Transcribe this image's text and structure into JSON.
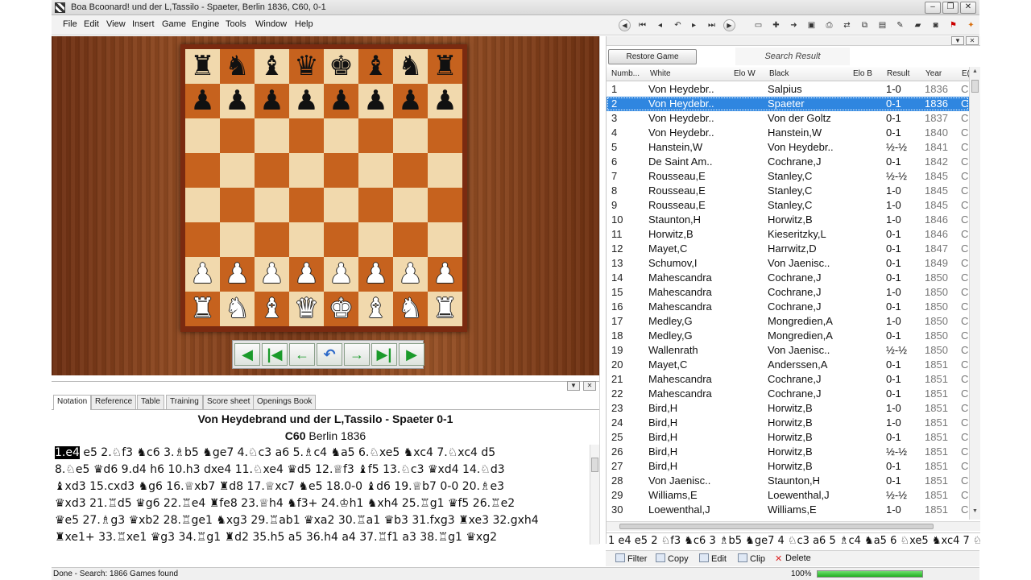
{
  "window": {
    "title": "Boa Bcoonard! und der L,Tassilo - Spaeter, Berlin 1836, C60, 0-1",
    "controls": [
      "–",
      "❐",
      "✕"
    ]
  },
  "menu": [
    "File",
    "Edit",
    "View",
    "Insert",
    "Game",
    "Engine",
    "Tools",
    "Window",
    "Help"
  ],
  "toolbar_icons": [
    "nav-back-icon",
    "nav-first-icon",
    "nav-prev-icon",
    "nav-undo-icon",
    "nav-next-icon",
    "nav-last-icon",
    "nav-forward-icon",
    "new-doc-icon",
    "insert-icon",
    "export-icon",
    "save-icon",
    "print-icon",
    "import-icon",
    "copy-icon",
    "clipboard-icon",
    "edit-icon",
    "eraser-icon",
    "camera-icon",
    "pdf-icon",
    "plugin-icon"
  ],
  "board": {
    "ranks": [
      [
        "r",
        "n",
        "b",
        "q",
        "k",
        "b",
        "n",
        "r"
      ],
      [
        "p",
        "p",
        "p",
        "p",
        "p",
        "p",
        "p",
        "p"
      ],
      [
        "",
        "",
        "",
        "",
        "",
        "",
        "",
        ""
      ],
      [
        "",
        "",
        "",
        "",
        "",
        "",
        "",
        ""
      ],
      [
        "",
        "",
        "",
        "",
        "",
        "",
        "",
        ""
      ],
      [
        "",
        "",
        "",
        "",
        "",
        "",
        "",
        ""
      ],
      [
        "P",
        "P",
        "P",
        "P",
        "P",
        "P",
        "P",
        "P"
      ],
      [
        "R",
        "N",
        "B",
        "Q",
        "K",
        "B",
        "N",
        "R"
      ]
    ],
    "light_color": "#f1d9ad",
    "dark_color": "#c6621e"
  },
  "nav_buttons": [
    {
      "name": "back-circle",
      "glyph": "◀"
    },
    {
      "name": "first-move",
      "glyph": "|◀"
    },
    {
      "name": "prev-move",
      "glyph": "←"
    },
    {
      "name": "take-back",
      "glyph": "↶"
    },
    {
      "name": "next-move",
      "glyph": "→"
    },
    {
      "name": "last-move",
      "glyph": "▶|"
    },
    {
      "name": "forward-circle",
      "glyph": "▶"
    }
  ],
  "notation": {
    "tabs": [
      "Notation",
      "Reference",
      "Table",
      "Training",
      "Score sheet",
      "Openings Book"
    ],
    "active_tab": "Notation",
    "header": "Von Heydebrand und der L,Tassilo - Spaeter  0-1",
    "eco": "C60",
    "event": "Berlin 1836",
    "current_move": "1.e4",
    "move_lines": [
      " e5 2.♘f3 ♞c6 3.♗b5 ♞ge7 4.♘c3 a6 5.♗c4 ♞a5 6.♘xe5 ♞xc4 7.♘xc4 d5",
      "8.♘e5 ♛d6 9.d4 h6 10.h3 dxe4 11.♘xe4 ♛d5 12.♕f3 ♝f5 13.♘c3 ♛xd4 14.♘d3",
      "♝xd3 15.cxd3 ♞g6 16.♕xb7 ♜d8 17.♕xc7 ♞e5 18.0-0 ♝d6 19.♕b7 0-0 20.♗e3",
      "♛xd3 21.♖d5 ♛g6 22.♖e4 ♜fe8 23.♕h4 ♞f3+ 24.♔h1 ♞xh4 25.♖g1 ♛f5 26.♖e2",
      "♛e5 27.♗g3 ♛xb2 28.♖ge1 ♞xg3 29.♖ab1 ♛xa2 30.♖a1 ♛b3 31.fxg3 ♜xe3 32.gxh4",
      "♜xe1+ 33.♖xe1 ♛g3 34.♖g1 ♜d2 35.h5 a5 36.h4 a4 37.♖f1 a3 38.♖g1 ♛xg2"
    ]
  },
  "game_list": {
    "restore_button": "Restore Game",
    "search_label": "Search Result",
    "columns": [
      "Numb...",
      "White",
      "Elo W",
      "Black",
      "Elo B",
      "Result",
      "Year",
      "E("
    ],
    "selected_index": 1,
    "rows": [
      {
        "num": "1",
        "white": "Von Heydebr..",
        "black": "Salpius",
        "result": "1-0",
        "year": "1836",
        "eco": "C"
      },
      {
        "num": "2",
        "white": "Von Heydebr..",
        "black": "Spaeter",
        "result": "0-1",
        "year": "1836",
        "eco": "C"
      },
      {
        "num": "3",
        "white": "Von Heydebr..",
        "black": "Von der Goltz",
        "result": "0-1",
        "year": "1837",
        "eco": "C"
      },
      {
        "num": "4",
        "white": "Von Heydebr..",
        "black": "Hanstein,W",
        "result": "0-1",
        "year": "1840",
        "eco": "C"
      },
      {
        "num": "5",
        "white": "Hanstein,W",
        "black": "Von Heydebr..",
        "result": "½-½",
        "year": "1841",
        "eco": "C"
      },
      {
        "num": "6",
        "white": "De Saint Am..",
        "black": "Cochrane,J",
        "result": "0-1",
        "year": "1842",
        "eco": "C"
      },
      {
        "num": "7",
        "white": "Rousseau,E",
        "black": "Stanley,C",
        "result": "½-½",
        "year": "1845",
        "eco": "C"
      },
      {
        "num": "8",
        "white": "Rousseau,E",
        "black": "Stanley,C",
        "result": "1-0",
        "year": "1845",
        "eco": "C"
      },
      {
        "num": "9",
        "white": "Rousseau,E",
        "black": "Stanley,C",
        "result": "1-0",
        "year": "1845",
        "eco": "C"
      },
      {
        "num": "10",
        "white": "Staunton,H",
        "black": "Horwitz,B",
        "result": "1-0",
        "year": "1846",
        "eco": "C"
      },
      {
        "num": "11",
        "white": "Horwitz,B",
        "black": "Kieseritzky,L",
        "result": "0-1",
        "year": "1846",
        "eco": "C"
      },
      {
        "num": "12",
        "white": "Mayet,C",
        "black": "Harrwitz,D",
        "result": "0-1",
        "year": "1847",
        "eco": "C"
      },
      {
        "num": "13",
        "white": "Schumov,I",
        "black": "Von Jaenisc..",
        "result": "0-1",
        "year": "1849",
        "eco": "C"
      },
      {
        "num": "14",
        "white": "Mahescandra",
        "black": "Cochrane,J",
        "result": "0-1",
        "year": "1850",
        "eco": "C"
      },
      {
        "num": "15",
        "white": "Mahescandra",
        "black": "Cochrane,J",
        "result": "1-0",
        "year": "1850",
        "eco": "C"
      },
      {
        "num": "16",
        "white": "Mahescandra",
        "black": "Cochrane,J",
        "result": "0-1",
        "year": "1850",
        "eco": "C"
      },
      {
        "num": "17",
        "white": "Medley,G",
        "black": "Mongredien,A",
        "result": "1-0",
        "year": "1850",
        "eco": "C"
      },
      {
        "num": "18",
        "white": "Medley,G",
        "black": "Mongredien,A",
        "result": "0-1",
        "year": "1850",
        "eco": "C"
      },
      {
        "num": "19",
        "white": "Wallenrath",
        "black": "Von Jaenisc..",
        "result": "½-½",
        "year": "1850",
        "eco": "C"
      },
      {
        "num": "20",
        "white": "Mayet,C",
        "black": "Anderssen,A",
        "result": "0-1",
        "year": "1851",
        "eco": "C"
      },
      {
        "num": "21",
        "white": "Mahescandra",
        "black": "Cochrane,J",
        "result": "0-1",
        "year": "1851",
        "eco": "C"
      },
      {
        "num": "22",
        "white": "Mahescandra",
        "black": "Cochrane,J",
        "result": "0-1",
        "year": "1851",
        "eco": "C"
      },
      {
        "num": "23",
        "white": "Bird,H",
        "black": "Horwitz,B",
        "result": "1-0",
        "year": "1851",
        "eco": "C"
      },
      {
        "num": "24",
        "white": "Bird,H",
        "black": "Horwitz,B",
        "result": "1-0",
        "year": "1851",
        "eco": "C"
      },
      {
        "num": "25",
        "white": "Bird,H",
        "black": "Horwitz,B",
        "result": "0-1",
        "year": "1851",
        "eco": "C"
      },
      {
        "num": "26",
        "white": "Bird,H",
        "black": "Horwitz,B",
        "result": "½-½",
        "year": "1851",
        "eco": "C"
      },
      {
        "num": "27",
        "white": "Bird,H",
        "black": "Horwitz,B",
        "result": "0-1",
        "year": "1851",
        "eco": "C"
      },
      {
        "num": "28",
        "white": "Von Jaenisc..",
        "black": "Staunton,H",
        "result": "0-1",
        "year": "1851",
        "eco": "C"
      },
      {
        "num": "29",
        "white": "Williams,E",
        "black": "Loewenthal,J",
        "result": "½-½",
        "year": "1851",
        "eco": "C"
      },
      {
        "num": "30",
        "white": "Loewenthal,J",
        "black": "Williams,E",
        "result": "1-0",
        "year": "1851",
        "eco": "C"
      }
    ],
    "move_preview": "1 e4 e5 2 ♘f3 ♞c6 3 ♗b5 ♞ge7 4 ♘c3 a6 5 ♗c4 ♞a5 6 ♘xe5 ♞xc4 7 ♘"
  },
  "actions": [
    {
      "name": "filter",
      "label": "Filter"
    },
    {
      "name": "copy",
      "label": "Copy"
    },
    {
      "name": "edit",
      "label": "Edit"
    },
    {
      "name": "clip",
      "label": "Clip"
    },
    {
      "name": "delete",
      "label": "Delete"
    }
  ],
  "status": {
    "text": "Done - Search: 1866 Games found",
    "zoom": "100%",
    "progress": 1.0
  }
}
